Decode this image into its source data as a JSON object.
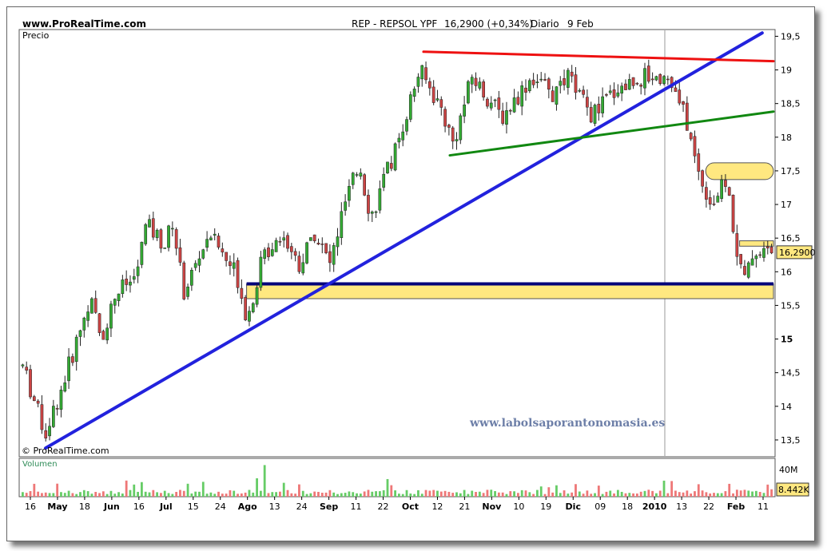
{
  "header": {
    "site": "www.ProRealTime.com",
    "instrument": "REP - REPSOL YPF",
    "quote": "16,2900 (+0,34%)",
    "period": "Diario",
    "date": "9 Feb"
  },
  "panels": {
    "price_label": "Precio",
    "copyright": "© ProRealTime.com",
    "watermark": "www.labolsaporantonomasia.es",
    "volume_label": "Volumen",
    "last_price_label": "16,2900",
    "volume_scale_label": "40M",
    "last_volume_label": "8.442K"
  },
  "colors": {
    "up": "#33aa33",
    "down": "#cc4444",
    "trend_blue": "#2222dd",
    "trend_red": "#ee1111",
    "trend_green": "#118811",
    "support_fill": "#ffe880",
    "support_line": "#00007a"
  },
  "chart_data": {
    "type": "candlestick",
    "x_labels": [
      "16",
      "May",
      "18",
      "Jun",
      "16",
      "Jul",
      "15",
      "24",
      "Ago",
      "13",
      "24",
      "Sep",
      "11",
      "22",
      "Oct",
      "12",
      "21",
      "Nov",
      "10",
      "19",
      "Dic",
      "09",
      "18",
      "2010",
      "13",
      "22",
      "Feb",
      "11"
    ],
    "y_ticks": [
      "19,5",
      "19",
      "18,5",
      "18",
      "17,5",
      "17",
      "16,5",
      "16",
      "15,5",
      "15",
      "14,5",
      "14",
      "13,5"
    ],
    "ylim": [
      13.25,
      19.6
    ],
    "last_price": 16.29,
    "trendlines": [
      {
        "name": "blue-uptrend",
        "from": [
          0.033,
          13.38
        ],
        "to": [
          0.985,
          19.55
        ]
      },
      {
        "name": "red-resistance",
        "from": [
          0.535,
          19.27
        ],
        "to": [
          1.0,
          19.13
        ]
      },
      {
        "name": "green-support",
        "from": [
          0.57,
          17.73
        ],
        "to": [
          1.0,
          18.38
        ]
      }
    ],
    "zones": [
      {
        "name": "support-band",
        "low": 15.6,
        "high": 15.82,
        "from": 0.3,
        "to": 1.0
      },
      {
        "name": "resistance-pill",
        "low": 17.37,
        "high": 17.62,
        "from": 0.91,
        "to": 1.0
      },
      {
        "name": "level-box",
        "low": 16.38,
        "high": 16.46,
        "from": 0.955,
        "to": 1.0
      }
    ],
    "anchors": [
      [
        0.0,
        14.6
      ],
      [
        0.03,
        13.6
      ],
      [
        0.05,
        14.2
      ],
      [
        0.09,
        15.6
      ],
      [
        0.105,
        15.0
      ],
      [
        0.125,
        15.7
      ],
      [
        0.15,
        15.9
      ],
      [
        0.165,
        16.7
      ],
      [
        0.19,
        16.4
      ],
      [
        0.2,
        16.75
      ],
      [
        0.215,
        15.7
      ],
      [
        0.235,
        16.2
      ],
      [
        0.25,
        16.6
      ],
      [
        0.27,
        16.2
      ],
      [
        0.285,
        16.0
      ],
      [
        0.3,
        15.3
      ],
      [
        0.32,
        16.2
      ],
      [
        0.345,
        16.6
      ],
      [
        0.37,
        16.1
      ],
      [
        0.39,
        16.6
      ],
      [
        0.41,
        16.1
      ],
      [
        0.43,
        17.0
      ],
      [
        0.45,
        17.6
      ],
      [
        0.465,
        16.8
      ],
      [
        0.5,
        17.9
      ],
      [
        0.53,
        19.0
      ],
      [
        0.56,
        18.4
      ],
      [
        0.575,
        17.9
      ],
      [
        0.6,
        18.9
      ],
      [
        0.64,
        18.3
      ],
      [
        0.68,
        18.9
      ],
      [
        0.71,
        18.6
      ],
      [
        0.73,
        18.9
      ],
      [
        0.76,
        18.3
      ],
      [
        0.79,
        18.7
      ],
      [
        0.83,
        18.9
      ],
      [
        0.86,
        18.9
      ],
      [
        0.885,
        18.3
      ],
      [
        0.9,
        17.55
      ],
      [
        0.92,
        17.0
      ],
      [
        0.94,
        17.35
      ],
      [
        0.955,
        16.2
      ],
      [
        0.965,
        15.85
      ],
      [
        0.975,
        16.3
      ],
      [
        1.0,
        16.3
      ]
    ],
    "volume_ylim": [
      0,
      40
    ],
    "volume_last": 8.442
  }
}
